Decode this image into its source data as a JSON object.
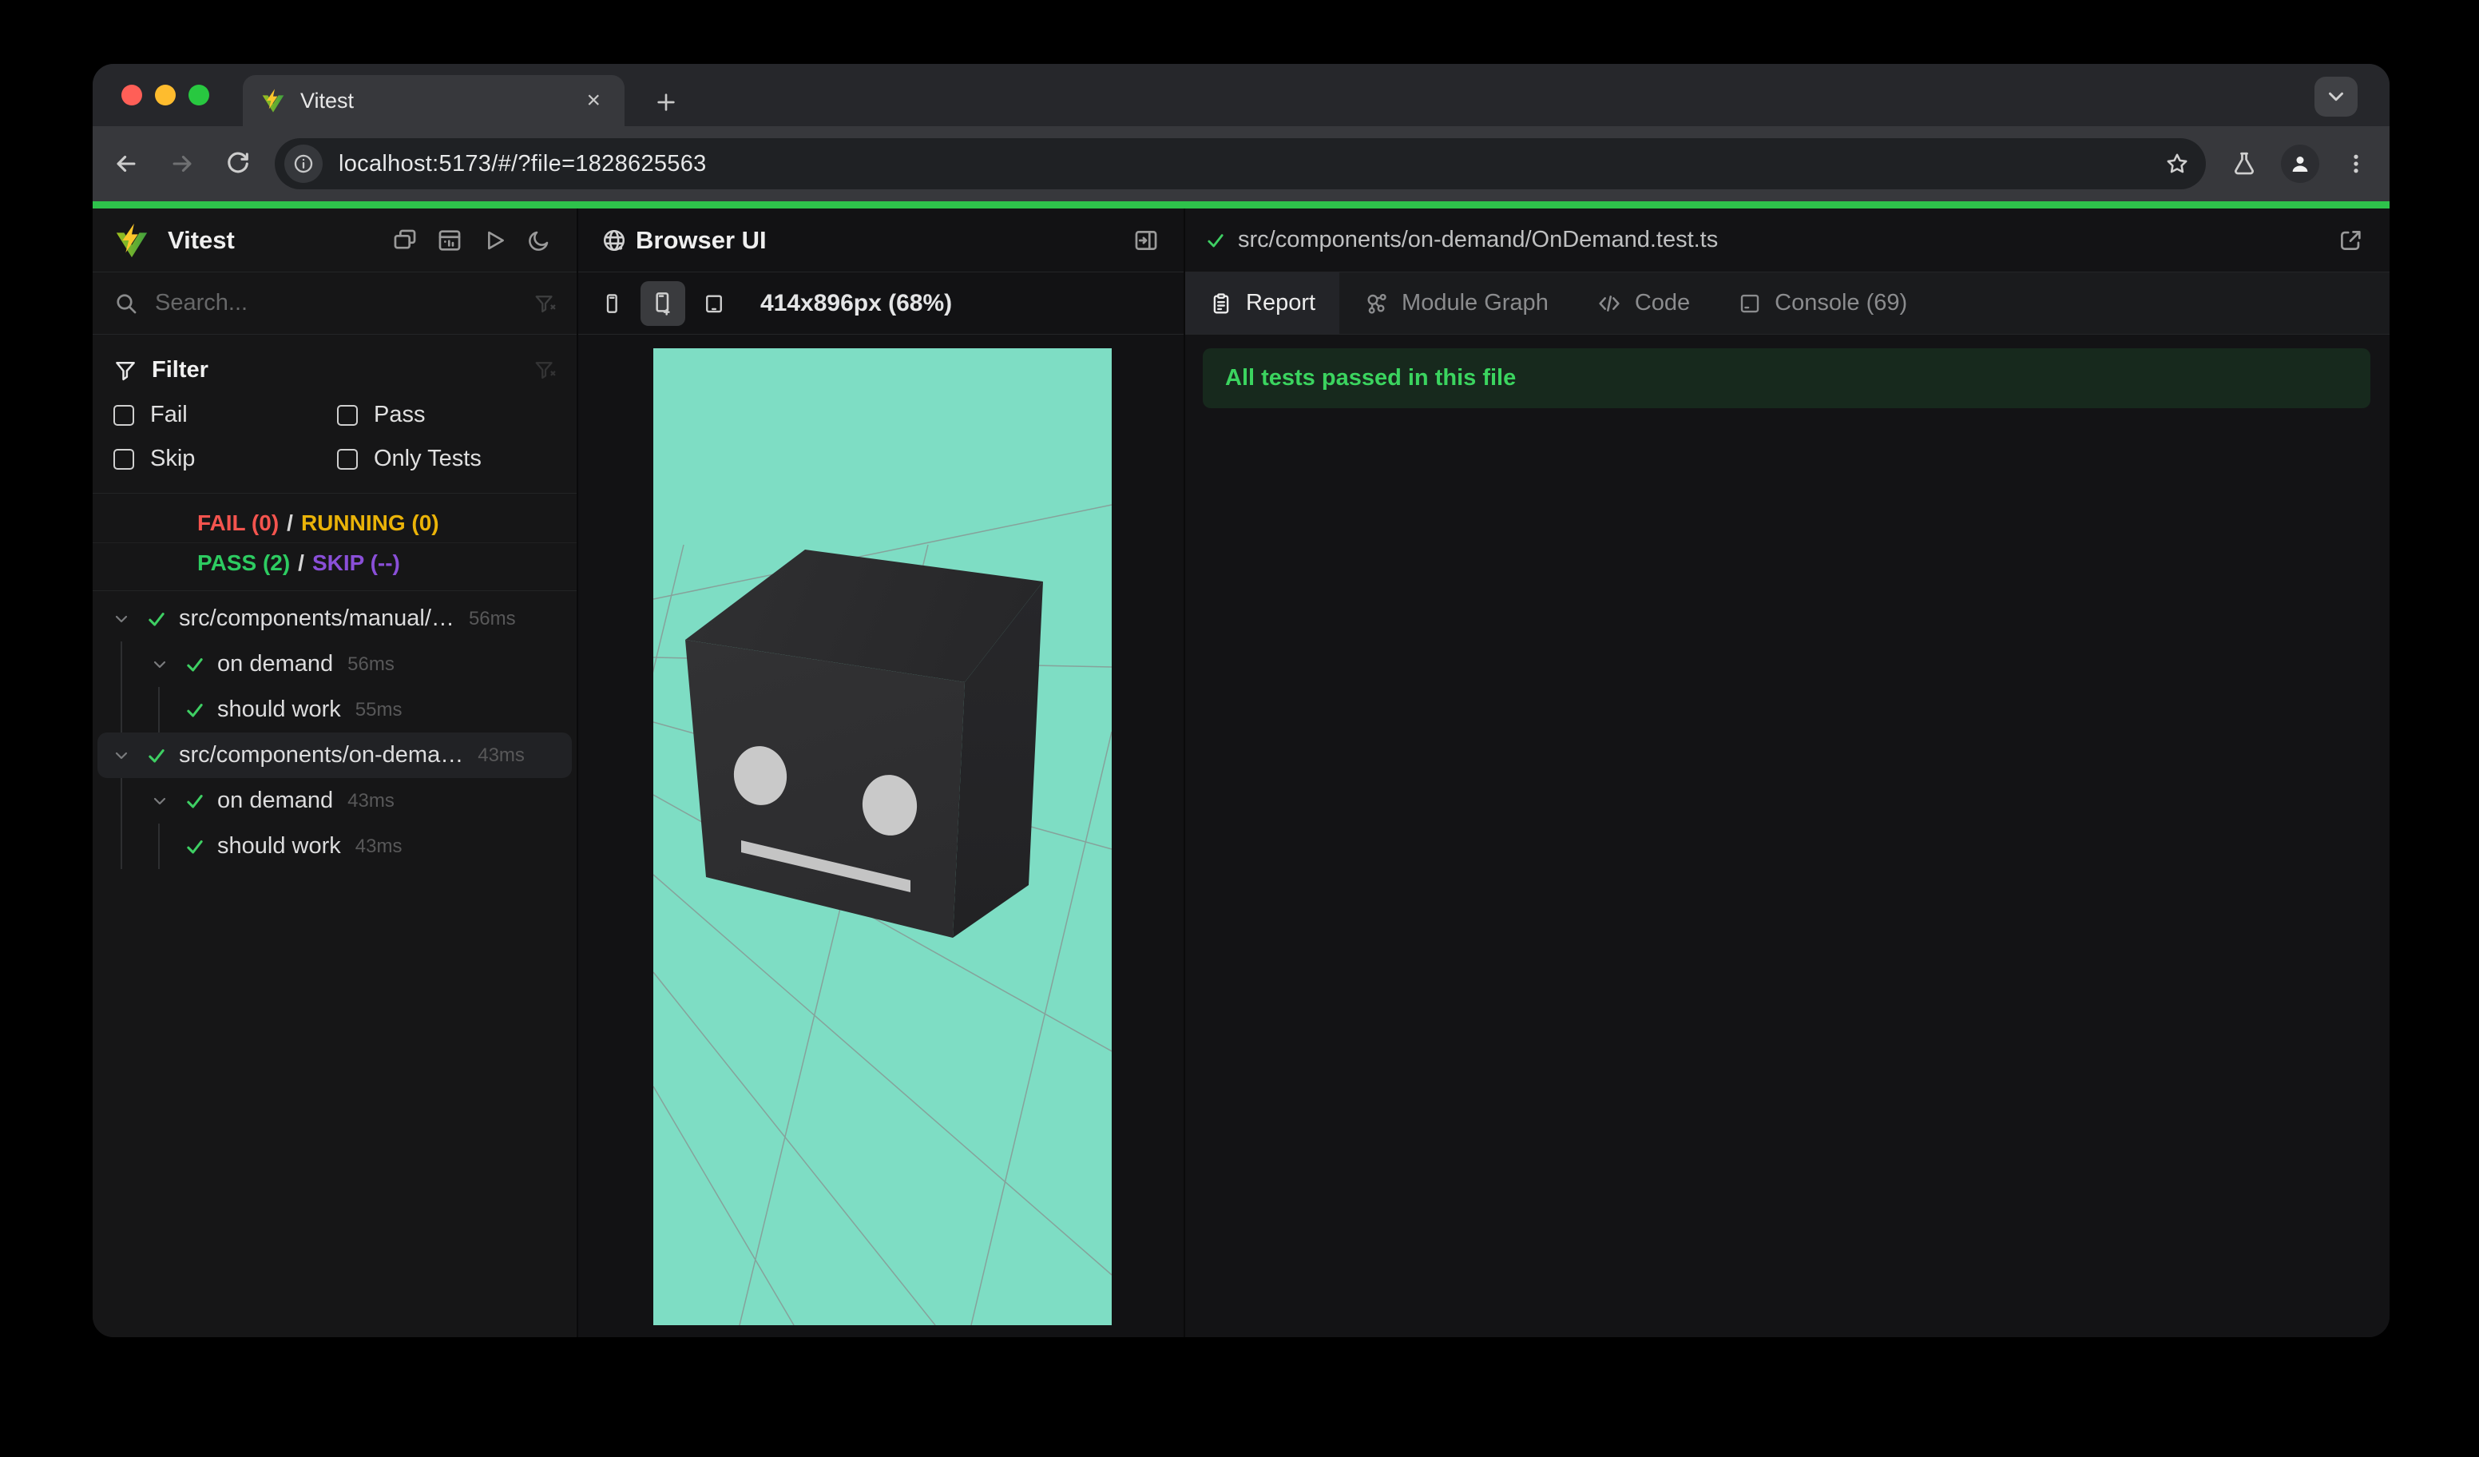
{
  "colors": {
    "accent-green": "#2ec24b",
    "check-green": "#3ecf63",
    "fail-red": "#f4544e",
    "running-amber": "#eab308",
    "pass-green": "#2dcc61",
    "skip-purple": "#8a4fd8",
    "banner-bg": "#17291d",
    "banner-text": "#3bd45f",
    "viewport-teal": "#7eddc4",
    "cube-front": "#2f2f30",
    "cube-top": "#2b2b2c",
    "cube-right": "#242425",
    "logo-yellow": "#fcc72b",
    "logo-green-1": "#9dbf1e",
    "logo-green-2": "#3fa13f"
  },
  "browser_chrome": {
    "tab_title": "Vitest",
    "url": "localhost:5173/#/?file=1828625563"
  },
  "icons": {
    "tab_close": "x",
    "new_tab": "+",
    "tab_search": "chevron-down",
    "omnibox_left": "info-circle",
    "omnibox_right": "star-outline",
    "toolbar_right": [
      "flask",
      "profile-avatar",
      "three-dot-menu"
    ],
    "sidebar_header": [
      "collapse-windows",
      "dashboard",
      "run-play",
      "dark-mode-moon"
    ],
    "device_buttons": [
      "phone-small",
      "phone-plus",
      "tablet"
    ]
  },
  "sidebar": {
    "app_name": "Vitest",
    "search_placeholder": "Search...",
    "filter": {
      "title": "Filter",
      "options": [
        {
          "label": "Fail",
          "checked": false
        },
        {
          "label": "Pass",
          "checked": false
        },
        {
          "label": "Skip",
          "checked": false
        },
        {
          "label": "Only Tests",
          "checked": false
        }
      ]
    },
    "summary": {
      "fail": "FAIL (0)",
      "running": "RUNNING (0)",
      "pass": "PASS (2)",
      "skip": "SKIP (--)",
      "separator": "/"
    },
    "tree": [
      {
        "label": "src/components/manual/…",
        "duration": "56ms",
        "level": 0,
        "status": "pass"
      },
      {
        "label": "on demand",
        "duration": "56ms",
        "level": 1,
        "status": "pass"
      },
      {
        "label": "should work",
        "duration": "55ms",
        "level": 2,
        "status": "pass"
      },
      {
        "label": "src/components/on-dema…",
        "duration": "43ms",
        "level": 0,
        "status": "pass",
        "selected": true
      },
      {
        "label": "on demand",
        "duration": "43ms",
        "level": 1,
        "status": "pass"
      },
      {
        "label": "should work",
        "duration": "43ms",
        "level": 2,
        "status": "pass"
      }
    ]
  },
  "browser_ui_panel": {
    "title": "Browser UI",
    "viewport_label": "414x896px (68%)"
  },
  "report_panel": {
    "file_path": "src/components/on-demand/OnDemand.test.ts",
    "tabs": [
      {
        "label": "Report",
        "active": true
      },
      {
        "label": "Module Graph",
        "active": false
      },
      {
        "label": "Code",
        "active": false
      },
      {
        "label": "Console (69)",
        "active": false
      }
    ],
    "banner": "All tests passed in this file"
  }
}
